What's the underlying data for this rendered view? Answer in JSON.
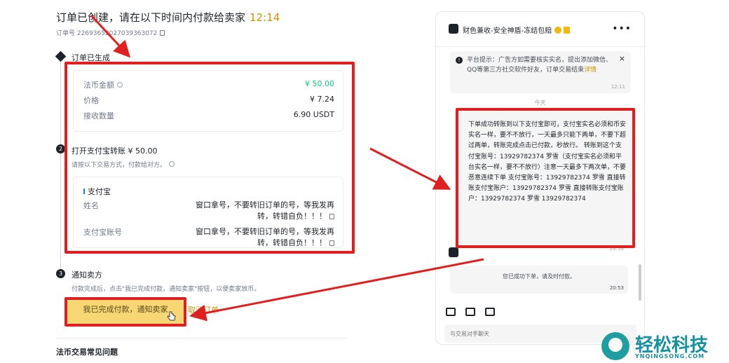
{
  "header": {
    "title": "订单已创建，请在以下时间内付款给卖家",
    "timer": "12:14",
    "order_no": "订单号 22693652027039363072"
  },
  "steps": [
    {
      "label": "订单已生成"
    },
    {
      "label": "打开支付宝转账 ¥ 50.00",
      "hint": "请按以下交易方式，付款给对方。"
    },
    {
      "label": "通知卖方",
      "hint": "付款完成后，点击\"我已完成付款，通知卖家\"按钮，以便卖家放币。"
    }
  ],
  "order_card": {
    "fiat_label": "法币金额",
    "fiat_value": "¥ 50.00",
    "price_label": "价格",
    "price_value": "¥ 7.24",
    "qty_label": "接收数量",
    "qty_value": "6.90 USDT"
  },
  "payment_card": {
    "method": "支付宝",
    "name_label": "姓名",
    "name_value": "窗口拿号，不要转旧订单的号，等我发再转，转错自负！！！",
    "account_label": "支付宝账号",
    "account_value": "窗口拿号，不要转旧订单的号，等我发再转，转错自负！！！"
  },
  "actions": {
    "confirm_label": "我已完成付款，通知卖家",
    "cancel_label": "取消订单"
  },
  "faq_title": "法币交易常见问题",
  "chat": {
    "name": "财色兼收-安全神盾-冻结包赔",
    "notice": "平台提示：广告方如需要核实实名，提出添加微信、QQ等第三方社交软件好友，订单交易结束",
    "notice_more": "详情",
    "notice_time": "12:11",
    "today": "今天",
    "message": "下单成功转账到以下支付宝即可，支付宝实名必须和币安实名一样，要不不放行，一天最多只能下两单，不要下超过两单，转账完成点击已付款，秒放行。 转账到这个支付宝账号：13929782374 罗雪（支付宝实名必须和平台实名一样，要不不放行）注意一天最多下两次单，不要恶意连续下单 支付宝账号：13929782374 罗雪 直接转账支付宝账户：13929782374 罗雪 直接转账支付宝账户：13929782374 罗雪 13929782374",
    "message_time": "20:53",
    "system_msg": "您已成功下单，请及时付款。",
    "system_time": "20:53",
    "input_placeholder": "与交易对手聊天"
  },
  "watermark": {
    "text": "轻松科技",
    "url": "YNQINGSONG.COM"
  },
  "colors": {
    "accent_yellow": "#f0b90b",
    "green": "#0ecb81",
    "annotation_red": "#e02020",
    "watermark_teal": "#1592a0"
  }
}
